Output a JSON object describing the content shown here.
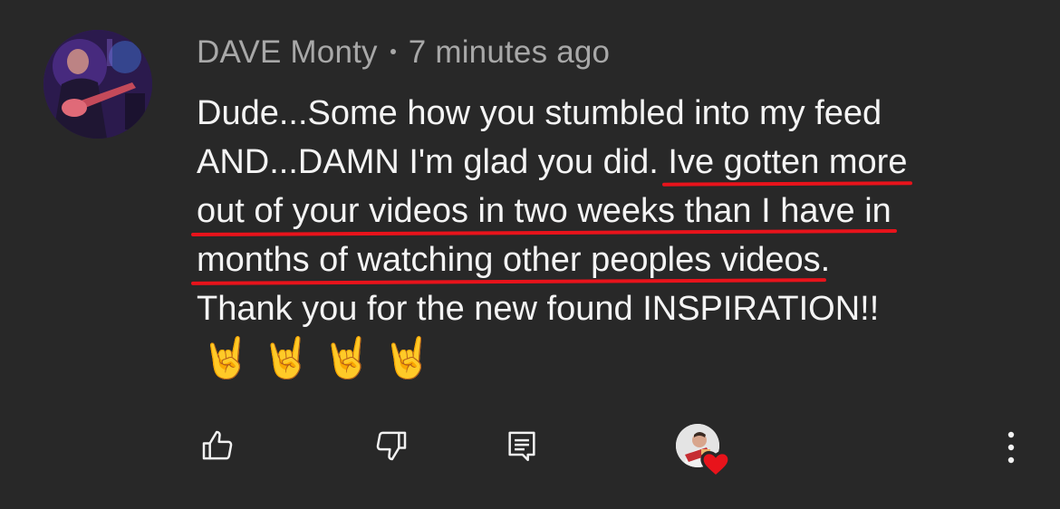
{
  "comment": {
    "author": "DAVE Monty",
    "timestamp": "7 minutes ago",
    "lines": [
      {
        "pre": "Dude...Some how you stumbled into my feed",
        "hl": "",
        "post": ""
      },
      {
        "pre": "AND...DAMN I'm glad you did. ",
        "hl": "Ive gotten more",
        "post": ""
      },
      {
        "pre": "",
        "hl": "out of your videos in two weeks than I have in",
        "post": ""
      },
      {
        "pre": "",
        "hl": "months of watching other peoples videos",
        "post": "."
      },
      {
        "pre": "Thank you for the new found INSPIRATION!!",
        "hl": "",
        "post": ""
      }
    ],
    "emojis": "🤘🤘🤘🤘"
  },
  "actions": {
    "like_icon": "thumbs-up-icon",
    "dislike_icon": "thumbs-down-icon",
    "reply_icon": "reply-comment-icon",
    "creator_heart_icon": "creator-heart-icon",
    "more_icon": "more-vertical-icon"
  },
  "colors": {
    "background": "#282828",
    "text": "#f4f4f4",
    "meta": "#a8a8a8",
    "highlight_underline": "#e8131b",
    "heart": "#e8131b"
  }
}
